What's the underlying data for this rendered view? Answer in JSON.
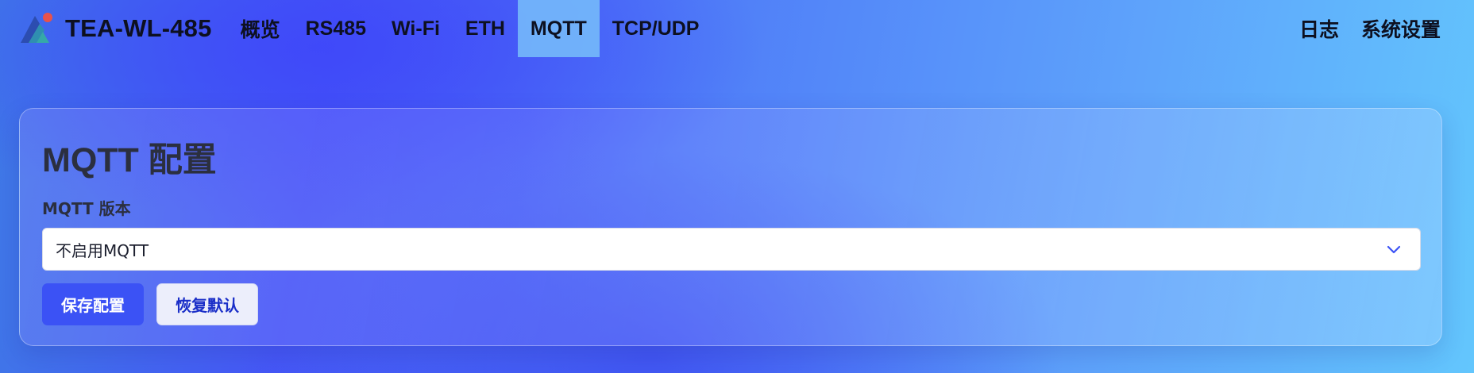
{
  "app": {
    "brand": "TEA-WL-485"
  },
  "nav": {
    "items": [
      {
        "label": "概览"
      },
      {
        "label": "RS485"
      },
      {
        "label": "Wi-Fi"
      },
      {
        "label": "ETH"
      },
      {
        "label": "MQTT",
        "active": true
      },
      {
        "label": "TCP/UDP"
      }
    ],
    "right_items": [
      {
        "label": "日志"
      },
      {
        "label": "系统设置"
      }
    ]
  },
  "card": {
    "title": "MQTT 配置",
    "version_field": {
      "label": "MQTT 版本",
      "selected": "不启用MQTT",
      "icon": "chevron-down-icon"
    },
    "buttons": {
      "save": "保存配置",
      "reset": "恢复默认"
    }
  },
  "colors": {
    "accent": "#3b52f5",
    "nav_active": "#78befa",
    "logo_dot": "#e8524a",
    "logo_teal": "#35a9a8"
  }
}
